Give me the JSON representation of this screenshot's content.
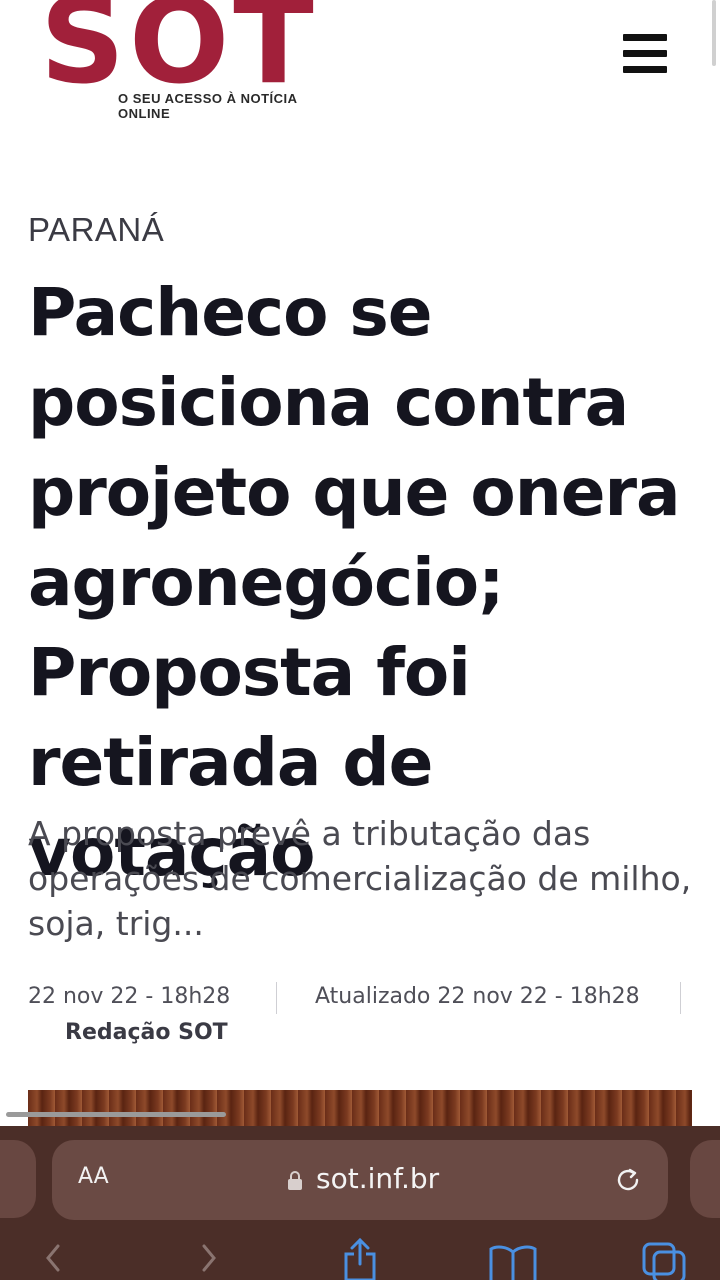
{
  "site": {
    "logo_text": "SOT",
    "tagline": "O SEU ACESSO À NOTÍCIA ONLINE"
  },
  "article": {
    "category": "PARANÁ",
    "headline": "Pacheco se posiciona contra projeto que onera agronegócio; Proposta foi retirada de votação",
    "summary": "A proposta prevê a tributação das operações de comercialização de milho, soja, trig...",
    "date": "22 nov 22 - 18h28",
    "updated": "Atualizado 22 nov 22 - 18h28",
    "author": "Redação SOT"
  },
  "browser": {
    "text_size_label": "AA",
    "url": "sot.inf.br"
  },
  "icons": {
    "menu": "hamburger-menu-icon",
    "lock": "lock-icon",
    "reload": "reload-icon",
    "back": "chevron-left-icon",
    "forward": "chevron-right-icon",
    "share": "share-icon",
    "bookmarks": "book-icon",
    "tabs": "tabs-icon"
  },
  "colors": {
    "brand": "#a1203a",
    "browser_bar": "#4b2e28"
  }
}
